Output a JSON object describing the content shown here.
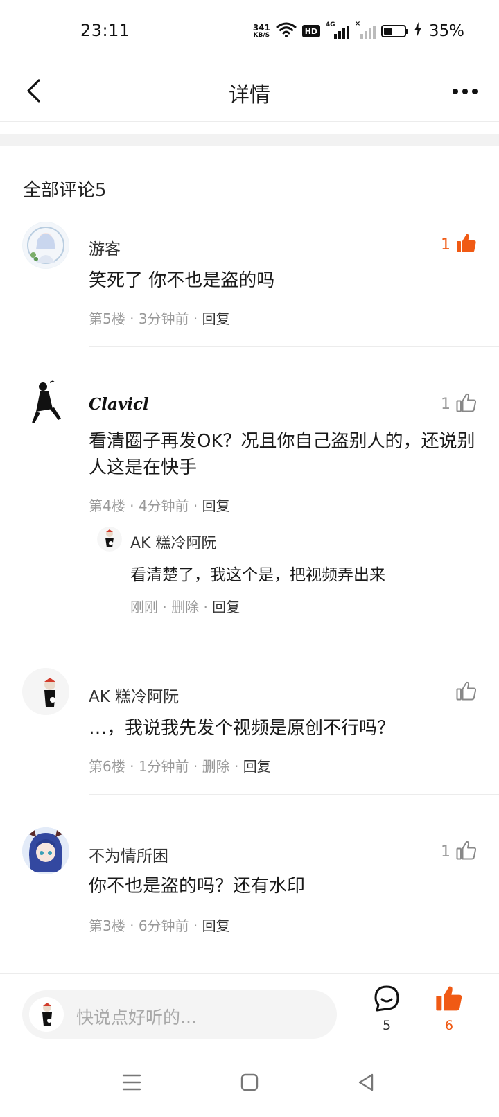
{
  "status_bar": {
    "time": "23:11",
    "net_speed_value": "341",
    "net_speed_unit": "KB/S",
    "hd_label": "HD",
    "network_label": "4G",
    "battery_percent": "35%"
  },
  "nav": {
    "title": "详情"
  },
  "comments_header": "全部评论5",
  "comments": [
    {
      "author": "游客",
      "content": "笑死了 你不也是盗的吗",
      "floor": "第5楼",
      "time": "3分钟前",
      "reply_label": "回复",
      "likes": "1",
      "liked": true
    },
    {
      "author": "Clavicl",
      "content": "看清圈子再发OK？况且你自己盗别人的，还说别人这是在快手",
      "floor": "第4楼",
      "time": "4分钟前",
      "reply_label": "回复",
      "likes": "1",
      "liked": false,
      "replies": [
        {
          "author": "AK  糕冷阿阮",
          "content": "看清楚了，我这个是，把视频弄出来",
          "time": "刚刚",
          "delete_label": "删除",
          "reply_label": "回复"
        }
      ]
    },
    {
      "author": "AK  糕冷阿阮",
      "content": "…，我说我先发个视频是原创不行吗？",
      "floor": "第6楼",
      "time": "1分钟前",
      "delete_label": "删除",
      "reply_label": "回复",
      "likes": "",
      "liked": false
    },
    {
      "author": "不为情所困",
      "content": "你不也是盗的吗？还有水印",
      "floor": "第3楼",
      "time": "6分钟前",
      "reply_label": "回复",
      "likes": "1",
      "liked": false
    }
  ],
  "bottom_bar": {
    "input_placeholder": "快说点好听的...",
    "comment_count": "5",
    "like_count": "6"
  },
  "colors": {
    "accent": "#f05a14",
    "muted_text": "#999999",
    "divider": "#ececec"
  }
}
